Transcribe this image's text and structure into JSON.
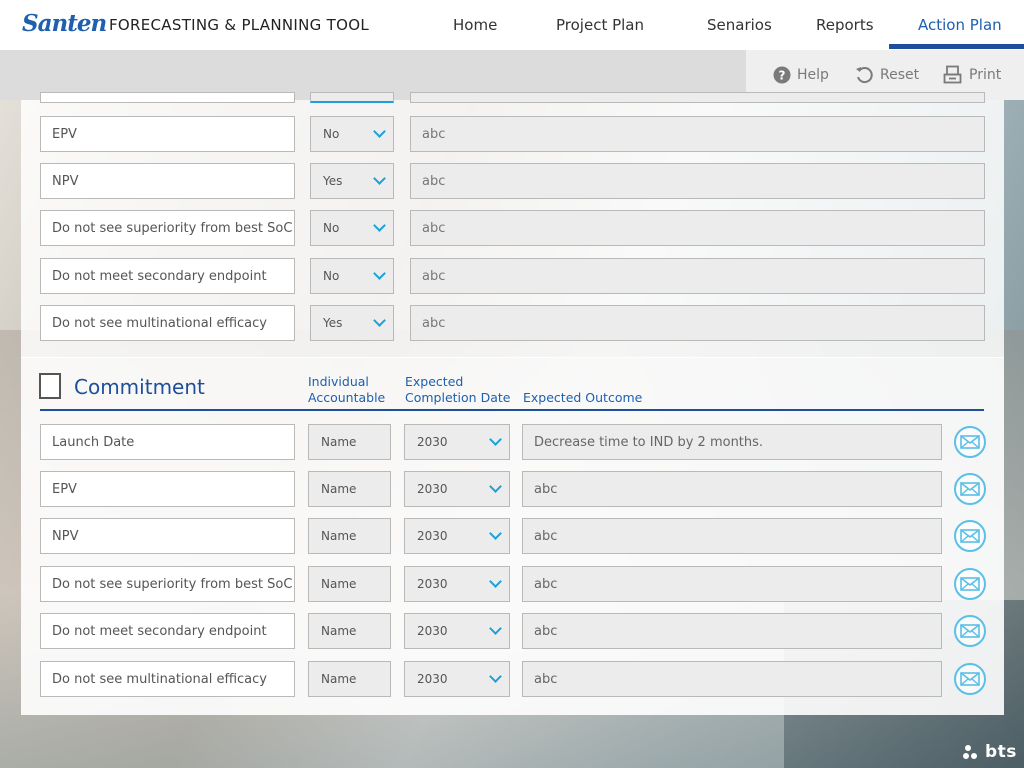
{
  "brand": {
    "logo_text": "Santen",
    "app_title": "FORECASTING & PLANNING TOOL",
    "footer_logo": "bts"
  },
  "nav": {
    "items": [
      {
        "label": "Home"
      },
      {
        "label": "Project Plan"
      },
      {
        "label": "Senarios"
      },
      {
        "label": "Reports"
      },
      {
        "label": "Action Plan",
        "active": true
      }
    ]
  },
  "toolbar": {
    "help_label": "Help",
    "reset_label": "Reset",
    "print_label": "Print"
  },
  "decision_rows": [
    {
      "label": "EPV",
      "choice": "No",
      "note": "abc"
    },
    {
      "label": "NPV",
      "choice": "Yes",
      "note": "abc"
    },
    {
      "label": "Do not see superiority from best SoC",
      "choice": "No",
      "note": "abc"
    },
    {
      "label": "Do not meet secondary endpoint",
      "choice": "No",
      "note": "abc"
    },
    {
      "label": "Do not see multinational efficacy",
      "choice": "Yes",
      "note": "abc"
    }
  ],
  "commitment": {
    "title": "Commitment",
    "col_accountable": [
      "Individual",
      "Accountable"
    ],
    "col_completion": [
      "Expected",
      "Completion Date"
    ],
    "col_outcome": "Expected Outcome",
    "rows": [
      {
        "label": "Launch Date",
        "name": "Name",
        "year": "2030",
        "outcome": "Decrease time to IND by 2 months."
      },
      {
        "label": "EPV",
        "name": "Name",
        "year": "2030",
        "outcome": "abc"
      },
      {
        "label": "NPV",
        "name": "Name",
        "year": "2030",
        "outcome": "abc"
      },
      {
        "label": "Do not see superiority from best SoC",
        "name": "Name",
        "year": "2030",
        "outcome": "abc"
      },
      {
        "label": "Do not meet secondary endpoint",
        "name": "Name",
        "year": "2030",
        "outcome": "abc"
      },
      {
        "label": "Do not see multinational efficacy",
        "name": "Name",
        "year": "2030",
        "outcome": "abc"
      }
    ]
  },
  "colors": {
    "brand_blue": "#1e4f9a",
    "accent_cyan": "#1ea0d8"
  }
}
